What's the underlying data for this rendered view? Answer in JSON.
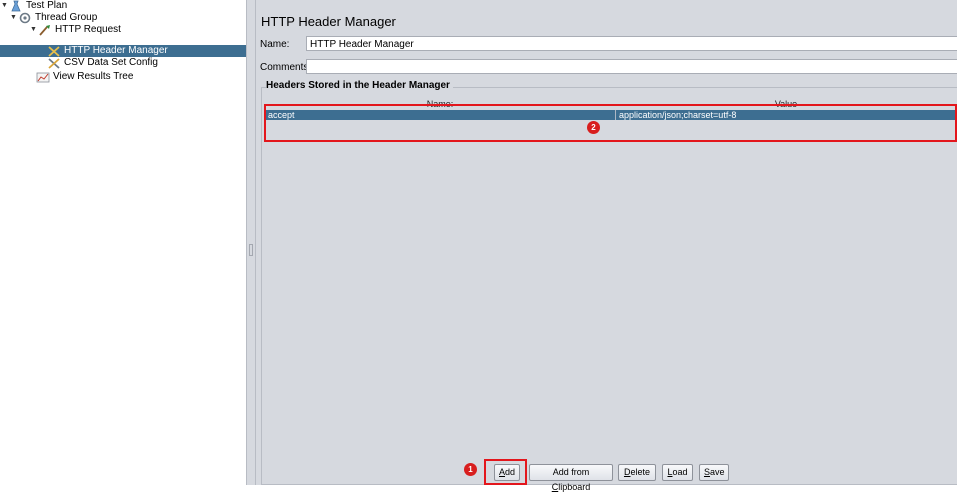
{
  "tree": {
    "items": [
      {
        "label": "Test Plan",
        "icon": "test-plan-icon",
        "expanded": true
      },
      {
        "label": "Thread Group",
        "icon": "thread-group-icon",
        "expanded": true
      },
      {
        "label": "HTTP Request",
        "icon": "http-request-icon",
        "expanded": true
      },
      {
        "label": "HTTP Header Manager",
        "icon": "config-element-icon",
        "selected": true
      },
      {
        "label": "CSV Data Set Config",
        "icon": "config-element-icon"
      },
      {
        "label": "View Results Tree",
        "icon": "listener-icon"
      }
    ]
  },
  "panel": {
    "title": "HTTP Header Manager",
    "name_label": "Name:",
    "name_value": "HTTP Header Manager",
    "comments_label": "Comments:",
    "comments_value": "",
    "headers_title": "Headers Stored in the Header Manager",
    "columns": [
      "Name:",
      "Value"
    ],
    "rows": [
      {
        "name": "accept",
        "value": "application/json;charset=utf-8"
      }
    ]
  },
  "buttons": {
    "add": {
      "prefix": "",
      "mnemonic": "A",
      "suffix": "dd"
    },
    "add_from_clipboard": {
      "prefix": "Add from ",
      "mnemonic": "C",
      "suffix": "lipboard"
    },
    "delete": {
      "prefix": "",
      "mnemonic": "D",
      "suffix": "elete"
    },
    "load": {
      "prefix": "",
      "mnemonic": "L",
      "suffix": "oad"
    },
    "save": {
      "prefix": "",
      "mnemonic": "S",
      "suffix": "ave"
    }
  },
  "annotations": {
    "badge_1": "1",
    "badge_2": "2",
    "highlight_color": "#e3161c"
  },
  "colors": {
    "selection": "#3d6e91",
    "panel_bg": "#d6d9df"
  }
}
